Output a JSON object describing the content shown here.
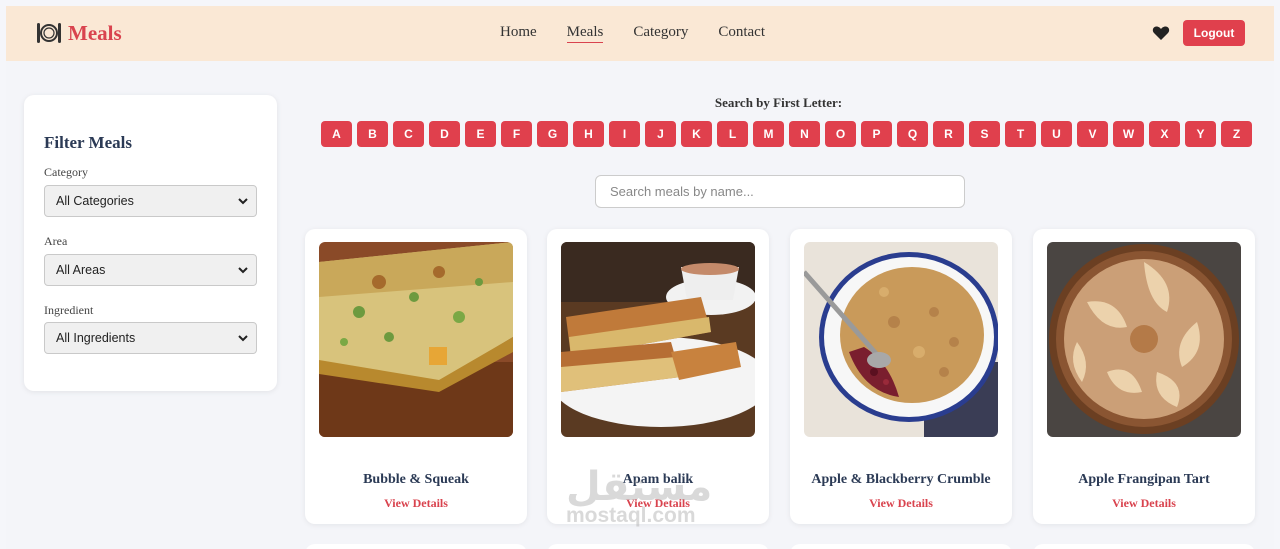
{
  "brand": {
    "name": "Meals"
  },
  "nav": {
    "links": [
      "Home",
      "Meals",
      "Category",
      "Contact"
    ],
    "active": "Meals",
    "logout_label": "Logout"
  },
  "filter": {
    "title": "Filter Meals",
    "category_label": "Category",
    "category_value": "All Categories",
    "area_label": "Area",
    "area_value": "All Areas",
    "ingredient_label": "Ingredient",
    "ingredient_value": "All Ingredients"
  },
  "search": {
    "letter_title": "Search by First Letter:",
    "letters": [
      "A",
      "B",
      "C",
      "D",
      "E",
      "F",
      "G",
      "H",
      "I",
      "J",
      "K",
      "L",
      "M",
      "N",
      "O",
      "P",
      "Q",
      "R",
      "S",
      "T",
      "U",
      "V",
      "W",
      "X",
      "Y",
      "Z"
    ],
    "placeholder": "Search meals by name..."
  },
  "meals": [
    {
      "title": "Bubble & Squeak",
      "link": "View Details",
      "image": "baked-vegetable-slice"
    },
    {
      "title": "Apam balik",
      "link": "View Details",
      "image": "folded-pancake"
    },
    {
      "title": "Apple & Blackberry Crumble",
      "link": "View Details",
      "image": "crumble-dish"
    },
    {
      "title": "Apple Frangipan Tart",
      "link": "View Details",
      "image": "apple-tart"
    }
  ],
  "watermark": {
    "arabic": "مستقل",
    "latin": "mostaql.com"
  },
  "colors": {
    "accent": "#e0404d",
    "navbar": "#fae8d5",
    "heading": "#2b3a55"
  }
}
